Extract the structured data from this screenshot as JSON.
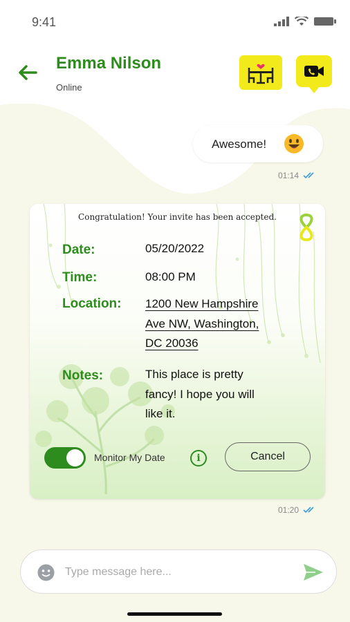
{
  "status_bar": {
    "time": "9:41"
  },
  "header": {
    "contact_name": "Emma Nilson",
    "contact_status": "Online",
    "icons": [
      "back-arrow-icon",
      "date-table-icon",
      "video-camera-icon"
    ]
  },
  "messages": [
    {
      "text": "Awesome!",
      "emoji": "grinning-face",
      "time": "01:14",
      "read": true
    }
  ],
  "invite": {
    "header": "Congratulation! Your invite has been accepted.",
    "date_label": "Date:",
    "date_value": "05/20/2022",
    "time_label": "Time:",
    "time_value": "08:00 PM",
    "location_label": "Location:",
    "location_lines": [
      "1200 New Hampshire",
      "Ave NW, Washington,",
      "DC 20036"
    ],
    "notes_label": "Notes:",
    "notes_lines": [
      "This place is pretty",
      "fancy! I hope you will",
      "like it."
    ],
    "monitor_label": "Monitor My Date",
    "monitor_enabled": true,
    "cancel_label": "Cancel",
    "time": "01:20",
    "read": true
  },
  "composer": {
    "placeholder": "Type message here..."
  },
  "colors": {
    "brand_green": "#2e8b1e",
    "accent_yellow": "#f2ea1a",
    "chat_background": "#f8f8ea",
    "read_tick": "#3a9bdc"
  }
}
